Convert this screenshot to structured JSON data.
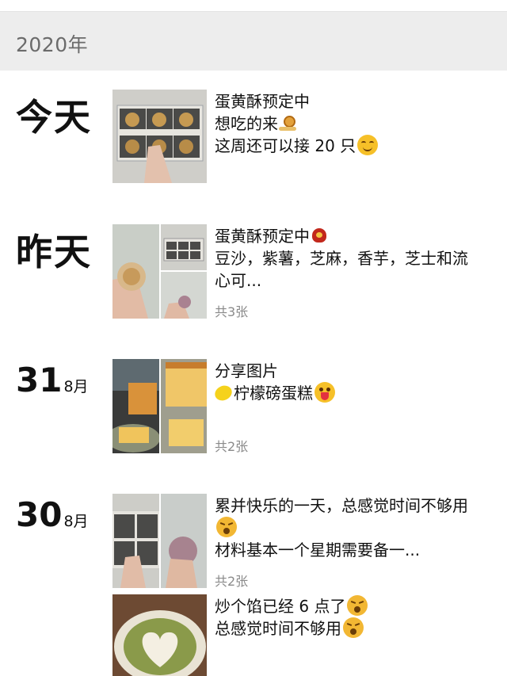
{
  "year": "2020年",
  "posts": [
    {
      "date": "今天",
      "lines": [
        "蛋黄酥预定中",
        "想吃的来",
        "这周还可以接 20 只"
      ],
      "icons": [
        "snail-icon",
        "smile-emoji"
      ]
    },
    {
      "date": "昨天",
      "lines": [
        "蛋黄酥预定中",
        "豆沙，紫薯，芝麻，香芋，芝士和流",
        "心可..."
      ],
      "count": "共3张",
      "icons": [
        "rooster-icon"
      ]
    },
    {
      "day": "31",
      "month": "8月",
      "lines": [
        "分享图片",
        "柠檬磅蛋糕"
      ],
      "count": "共2张",
      "icons": [
        "lemon-icon",
        "tongue-emoji"
      ]
    },
    {
      "day": "30",
      "month": "8月",
      "lines": [
        "累并快乐的一天，总感觉时间不够用",
        "材料基本一个星期需要备一..."
      ],
      "count": "共2张",
      "icons": [
        "tired-emoji"
      ]
    },
    {
      "lines": [
        "炒个馅已经 6 点了",
        "总感觉时间不够用"
      ],
      "icons": [
        "tired-emoji",
        "tired-emoji"
      ]
    }
  ]
}
